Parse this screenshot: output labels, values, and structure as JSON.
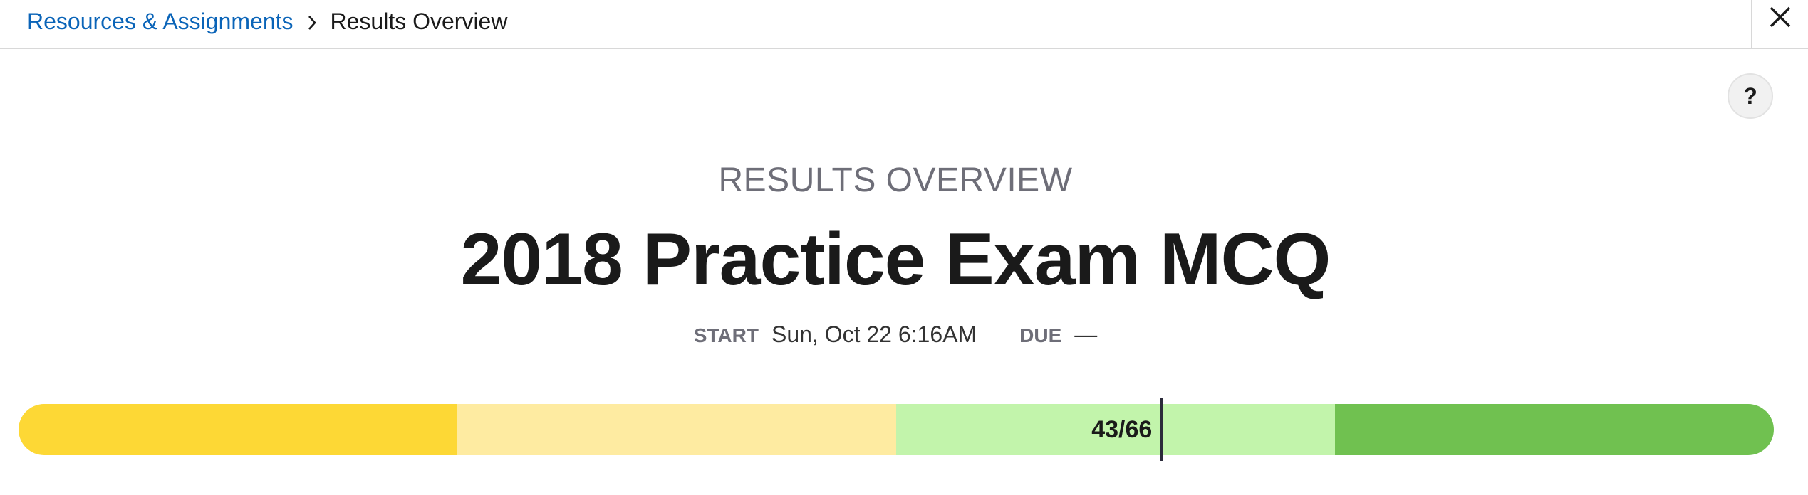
{
  "breadcrumb": {
    "parent": "Resources & Assignments",
    "current": "Results Overview"
  },
  "help_label": "?",
  "header": {
    "eyebrow": "RESULTS OVERVIEW",
    "title": "2018 Practice Exam MCQ"
  },
  "meta": {
    "start_label": "START",
    "start_value": "Sun, Oct 22 6:16AM",
    "due_label": "DUE",
    "due_value": "—"
  },
  "score": {
    "label": "43/66",
    "correct": 43,
    "total": 66
  },
  "progress_bands": [
    {
      "name": "band-1",
      "color": "#fdd835"
    },
    {
      "name": "band-2",
      "color": "#feeba1"
    },
    {
      "name": "band-3",
      "color": "#c2f4ab"
    },
    {
      "name": "band-4",
      "color": "#70c150"
    }
  ],
  "icons": {
    "close": "close-icon",
    "breadcrumb_separator": "chevron-right-icon",
    "help": "help-icon"
  }
}
